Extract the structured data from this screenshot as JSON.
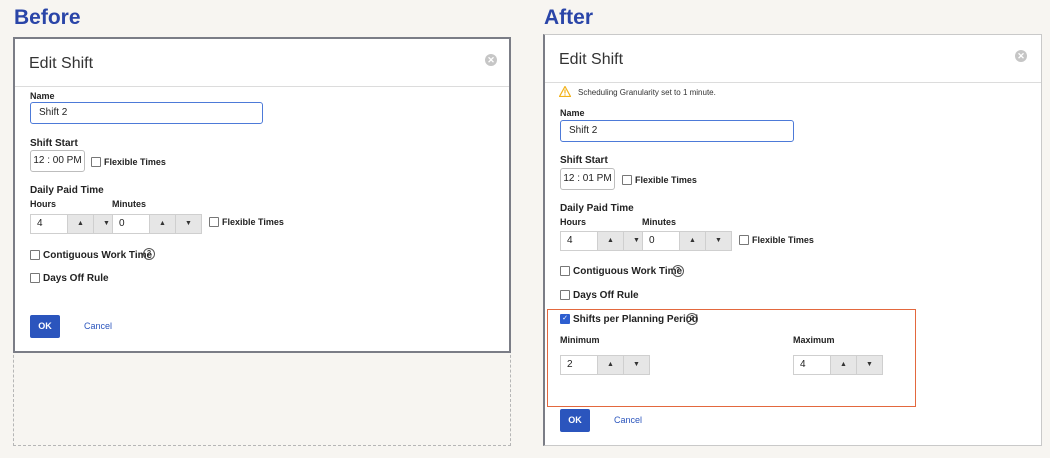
{
  "before": {
    "heading": "Before",
    "dialog_title": "Edit Shift",
    "name_label": "Name",
    "name_value": "Shift 2",
    "shift_start_label": "Shift Start",
    "shift_start_time": "12 : 00  PM",
    "flexible_times_label": "Flexible Times",
    "daily_paid_time_label": "Daily Paid Time",
    "hours_label": "Hours",
    "minutes_label": "Minutes",
    "hours_value": "4",
    "minutes_value": "0",
    "contiguous_label": "Contiguous Work Time",
    "days_off_label": "Days Off Rule",
    "ok_label": "OK",
    "cancel_label": "Cancel"
  },
  "after": {
    "heading": "After",
    "dialog_title": "Edit Shift",
    "warning_text": "Scheduling Granularity set to 1 minute.",
    "name_label": "Name",
    "name_value": "Shift 2",
    "shift_start_label": "Shift Start",
    "shift_start_time": "12 : 01  PM",
    "flexible_times_label": "Flexible Times",
    "daily_paid_time_label": "Daily Paid Time",
    "hours_label": "Hours",
    "minutes_label": "Minutes",
    "hours_value": "4",
    "minutes_value": "0",
    "contiguous_label": "Contiguous Work Time",
    "days_off_label": "Days Off Rule",
    "shifts_per_period_label": "Shifts per Planning Period",
    "minimum_label": "Minimum",
    "maximum_label": "Maximum",
    "minimum_value": "2",
    "maximum_value": "4",
    "ok_label": "OK",
    "cancel_label": "Cancel"
  },
  "icons": {
    "close": "close-icon",
    "help": "help-icon",
    "warning": "warning-icon",
    "arrow_up": "arrow-up-icon",
    "arrow_down": "arrow-down-icon"
  },
  "colors": {
    "heading": "#2a45a8",
    "primary_button": "#2b55bd",
    "highlight_border": "#e3683e",
    "warning": "#f2b21b"
  }
}
